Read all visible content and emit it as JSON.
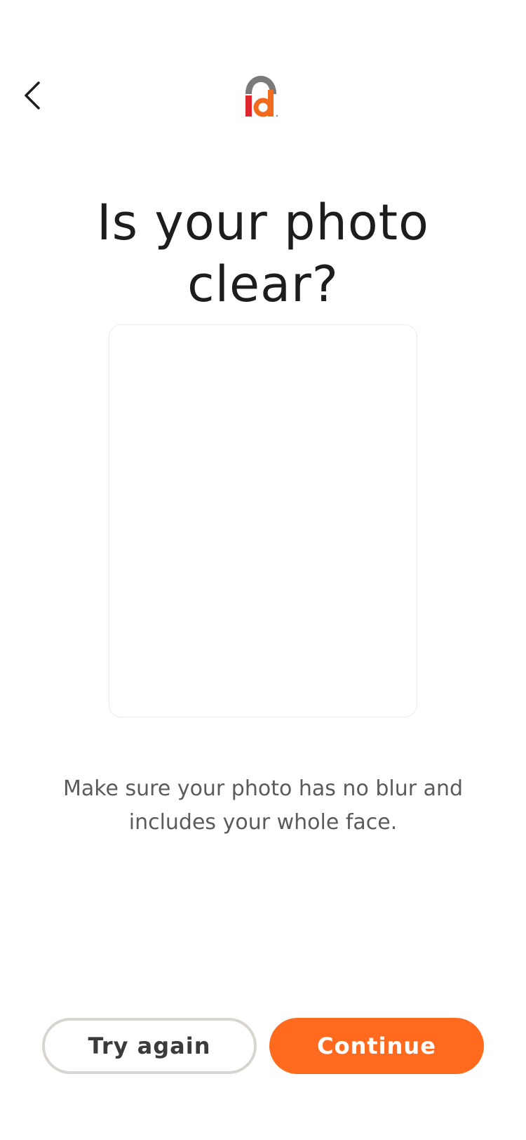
{
  "header": {
    "back_icon": "chevron-left-icon",
    "logo_icon": "id-logo-icon",
    "colors": {
      "logo_arc": "#7a7a7a",
      "logo_i": "#e0262e",
      "logo_d": "#f26a1b"
    }
  },
  "title": {
    "line1": "Is your photo",
    "line2": "clear?"
  },
  "help_text": {
    "line1": "Make sure your photo has no blur and",
    "line2": "includes your whole face."
  },
  "buttons": {
    "try_again": "Try again",
    "continue": "Continue"
  },
  "colors": {
    "accent": "#ff6a1f",
    "secondary_border": "#d8d4d0"
  }
}
